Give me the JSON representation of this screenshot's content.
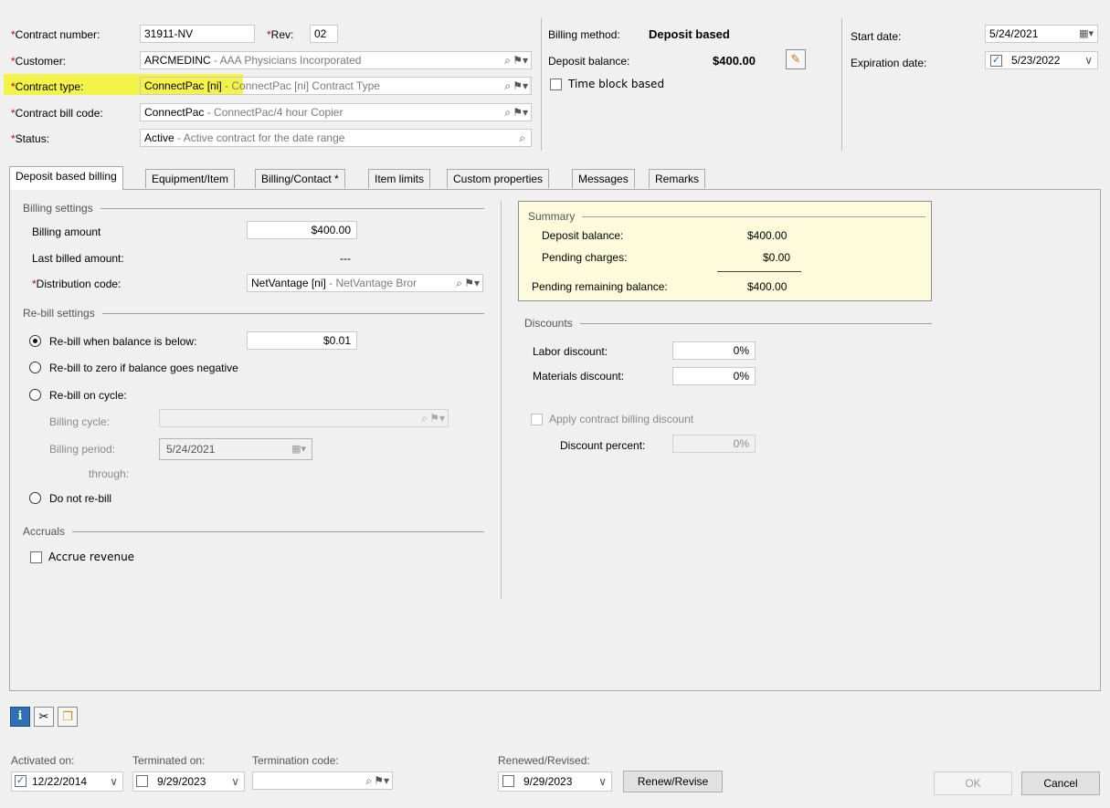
{
  "header": {
    "contract_number": {
      "label": "Contract number:",
      "value": "31911-NV"
    },
    "rev": {
      "label": "Rev:",
      "value": "02"
    },
    "customer": {
      "label": "Customer:",
      "code": "ARCMEDINC",
      "desc": " - AAA Physicians Incorporated"
    },
    "contract_type": {
      "label": "Contract type:",
      "code": "ConnectPac [ni]",
      "desc": " - ConnectPac [ni] Contract Type"
    },
    "bill_code": {
      "label": "Contract bill code:",
      "code": "ConnectPac",
      "desc": " - ConnectPac/4 hour Copier"
    },
    "status": {
      "label": "Status:",
      "code": "Active",
      "desc": " - Active contract for the date range"
    },
    "billing_method": {
      "label": "Billing method:",
      "value": "Deposit based"
    },
    "deposit_balance": {
      "label": "Deposit balance:",
      "value": "$400.00"
    },
    "time_block": {
      "label": "Time block based"
    },
    "start_date": {
      "label": "Start date:",
      "value": "5/24/2021"
    },
    "expiration_date": {
      "label": "Expiration date:",
      "value": "5/23/2022"
    }
  },
  "tabs": [
    "Deposit based billing",
    "Equipment/Item",
    "Billing/Contact *",
    "Item limits",
    "Custom properties",
    "Messages",
    "Remarks"
  ],
  "billing_settings": {
    "title": "Billing settings",
    "billing_amount": {
      "label": "Billing amount",
      "value": "$400.00"
    },
    "last_billed": {
      "label": "Last billed amount:",
      "value": "---"
    },
    "distribution": {
      "label": "Distribution code:",
      "code": "NetVantage [ni]",
      "desc": " - NetVantage Bror"
    }
  },
  "rebill": {
    "title": "Re-bill settings",
    "below": {
      "label": "Re-bill when balance is below:",
      "value": "$0.01"
    },
    "zero": "Re-bill to zero if balance goes negative",
    "cycle": "Re-bill on cycle:",
    "billing_cycle": "Billing cycle:",
    "billing_period": {
      "label": "Billing period:",
      "value": "5/24/2021"
    },
    "through": "through:",
    "none": "Do not re-bill"
  },
  "accruals": {
    "title": "Accruals",
    "accrue": "Accrue revenue"
  },
  "summary": {
    "title": "Summary",
    "deposit_balance": {
      "label": "Deposit balance:",
      "value": "$400.00"
    },
    "pending_charges": {
      "label": "Pending charges:",
      "value": "$0.00"
    },
    "remaining": {
      "label": "Pending remaining balance:",
      "value": "$400.00"
    }
  },
  "discounts": {
    "title": "Discounts",
    "labor": {
      "label": "Labor discount:",
      "value": "0%"
    },
    "materials": {
      "label": "Materials discount:",
      "value": "0%"
    },
    "apply": "Apply contract billing discount",
    "percent": {
      "label": "Discount percent:",
      "value": "0%"
    }
  },
  "footer": {
    "activated": {
      "label": "Activated on:",
      "value": "12/22/2014"
    },
    "terminated": {
      "label": "Terminated on:",
      "value": "9/29/2023"
    },
    "termination_code": {
      "label": "Termination code:",
      "value": ""
    },
    "renewed": {
      "label": "Renewed/Revised:",
      "value": "9/29/2023"
    },
    "renew_button": "Renew/Revise",
    "ok": "OK",
    "cancel": "Cancel"
  },
  "icons": {
    "info": "info-icon",
    "attach": "paperclip-icon",
    "copy": "copy-icon"
  },
  "colors": {
    "highlight": "#f3f34a",
    "summary_bg": "#fdfbdc",
    "required": "#d00000",
    "check": "#1c66c9"
  }
}
